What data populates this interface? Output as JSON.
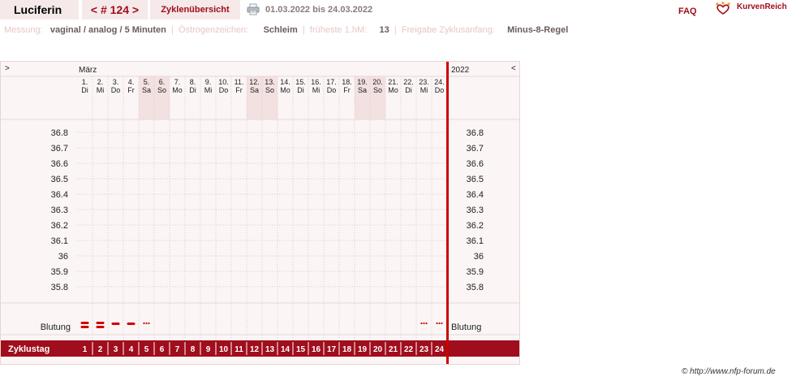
{
  "header": {
    "user": "Luciferin",
    "cycle_nav": "< # 124 >",
    "overview_link": "Zyklenübersicht",
    "date_range": "01.03.2022 bis 24.03.2022",
    "faq": "FAQ",
    "brand": "KurvenReich",
    "printer_icon": "printer-icon",
    "logo_icon": "crown-heart-icon"
  },
  "info": {
    "measurement_label": "Messung:",
    "measurement_value": "vaginal / analog / 5 Minuten",
    "estrogen_label": "Östrogenzeichen:",
    "estrogen_value": "Schleim",
    "earliest_label": "früheste 1.hM:",
    "earliest_value": "13",
    "release_label": "Freigabe Zyklusanfang:",
    "release_value": "Minus-8-Regel"
  },
  "chart": {
    "nav_left": ">",
    "nav_right": "<",
    "month": "März",
    "year": "2022",
    "bleeding_label": "Blutung",
    "cycle_day_label": "Zyklustag",
    "temperature_ticks": [
      "36.8",
      "36.7",
      "36.6",
      "36.5",
      "36.4",
      "36.3",
      "36.2",
      "36.1",
      "36",
      "35.9",
      "35.8"
    ],
    "days": [
      {
        "date": "1.",
        "wd": "Di",
        "weekend": false,
        "cycle_day": "1"
      },
      {
        "date": "2.",
        "wd": "Mi",
        "weekend": false,
        "cycle_day": "2"
      },
      {
        "date": "3.",
        "wd": "Do",
        "weekend": false,
        "cycle_day": "3"
      },
      {
        "date": "4.",
        "wd": "Fr",
        "weekend": false,
        "cycle_day": "4"
      },
      {
        "date": "5.",
        "wd": "Sa",
        "weekend": true,
        "cycle_day": "5"
      },
      {
        "date": "6.",
        "wd": "So",
        "weekend": true,
        "cycle_day": "6"
      },
      {
        "date": "7.",
        "wd": "Mo",
        "weekend": false,
        "cycle_day": "7"
      },
      {
        "date": "8.",
        "wd": "Di",
        "weekend": false,
        "cycle_day": "8"
      },
      {
        "date": "9.",
        "wd": "Mi",
        "weekend": false,
        "cycle_day": "9"
      },
      {
        "date": "10.",
        "wd": "Do",
        "weekend": false,
        "cycle_day": "10"
      },
      {
        "date": "11.",
        "wd": "Fr",
        "weekend": false,
        "cycle_day": "11"
      },
      {
        "date": "12.",
        "wd": "Sa",
        "weekend": true,
        "cycle_day": "12"
      },
      {
        "date": "13.",
        "wd": "So",
        "weekend": true,
        "cycle_day": "13"
      },
      {
        "date": "14.",
        "wd": "Mo",
        "weekend": false,
        "cycle_day": "14"
      },
      {
        "date": "15.",
        "wd": "Di",
        "weekend": false,
        "cycle_day": "15"
      },
      {
        "date": "16.",
        "wd": "Mi",
        "weekend": false,
        "cycle_day": "16"
      },
      {
        "date": "17.",
        "wd": "Do",
        "weekend": false,
        "cycle_day": "17"
      },
      {
        "date": "18.",
        "wd": "Fr",
        "weekend": false,
        "cycle_day": "18"
      },
      {
        "date": "19.",
        "wd": "Sa",
        "weekend": true,
        "cycle_day": "19"
      },
      {
        "date": "20.",
        "wd": "So",
        "weekend": true,
        "cycle_day": "20"
      },
      {
        "date": "21.",
        "wd": "Mo",
        "weekend": false,
        "cycle_day": "21"
      },
      {
        "date": "22.",
        "wd": "Di",
        "weekend": false,
        "cycle_day": "22"
      },
      {
        "date": "23.",
        "wd": "Mi",
        "weekend": false,
        "cycle_day": "23"
      },
      {
        "date": "24.",
        "wd": "Do",
        "weekend": false,
        "cycle_day": "24"
      }
    ],
    "bleeding": [
      "strong",
      "strong",
      "medium",
      "medium",
      "spotting",
      "",
      "",
      "",
      "",
      "",
      "",
      "",
      "",
      "",
      "",
      "",
      "",
      "",
      "",
      "",
      "",
      "",
      "spotting",
      "spotting"
    ],
    "colors": {
      "accent": "#a00d1c",
      "weekend": "#f3e0e0",
      "bleeding": "#cc0000"
    }
  },
  "footer": "© http://www.nfp-forum.de"
}
